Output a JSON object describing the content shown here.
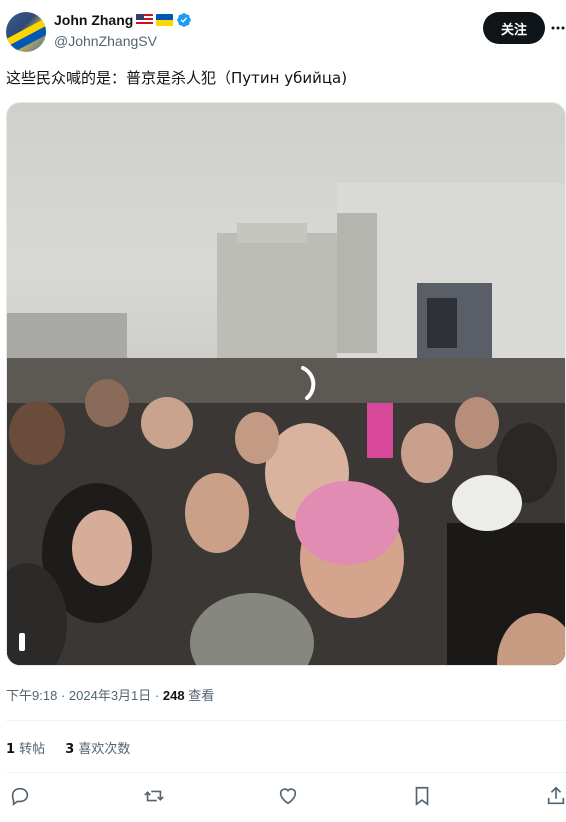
{
  "author": {
    "display_name": "John Zhang",
    "handle": "@JohnZhangSV",
    "flags": [
      "us-flag",
      "ukraine-flag"
    ],
    "verified": true
  },
  "follow_button": {
    "label": "关注"
  },
  "tweet": {
    "text": "这些民众喊的是：普京是杀人犯（Путин убийца)"
  },
  "media": {
    "type": "video",
    "description_icon": "loading-spinner-icon"
  },
  "meta": {
    "time": "下午9:18",
    "separator1": "·",
    "date": "2024年3月1日",
    "separator2": "·",
    "views_count": "248",
    "views_label": " 查看"
  },
  "stats": {
    "retweets_count": "1",
    "retweets_label": " 转帖",
    "likes_count": "3",
    "likes_label": " 喜欢次数"
  },
  "actions": [
    "reply-icon",
    "retweet-icon",
    "like-icon",
    "bookmark-icon",
    "share-icon"
  ],
  "colors": {
    "text": "#0f1419",
    "secondary": "#536471",
    "verified": "#1d9bf0",
    "follow_bg": "#0f1419"
  }
}
